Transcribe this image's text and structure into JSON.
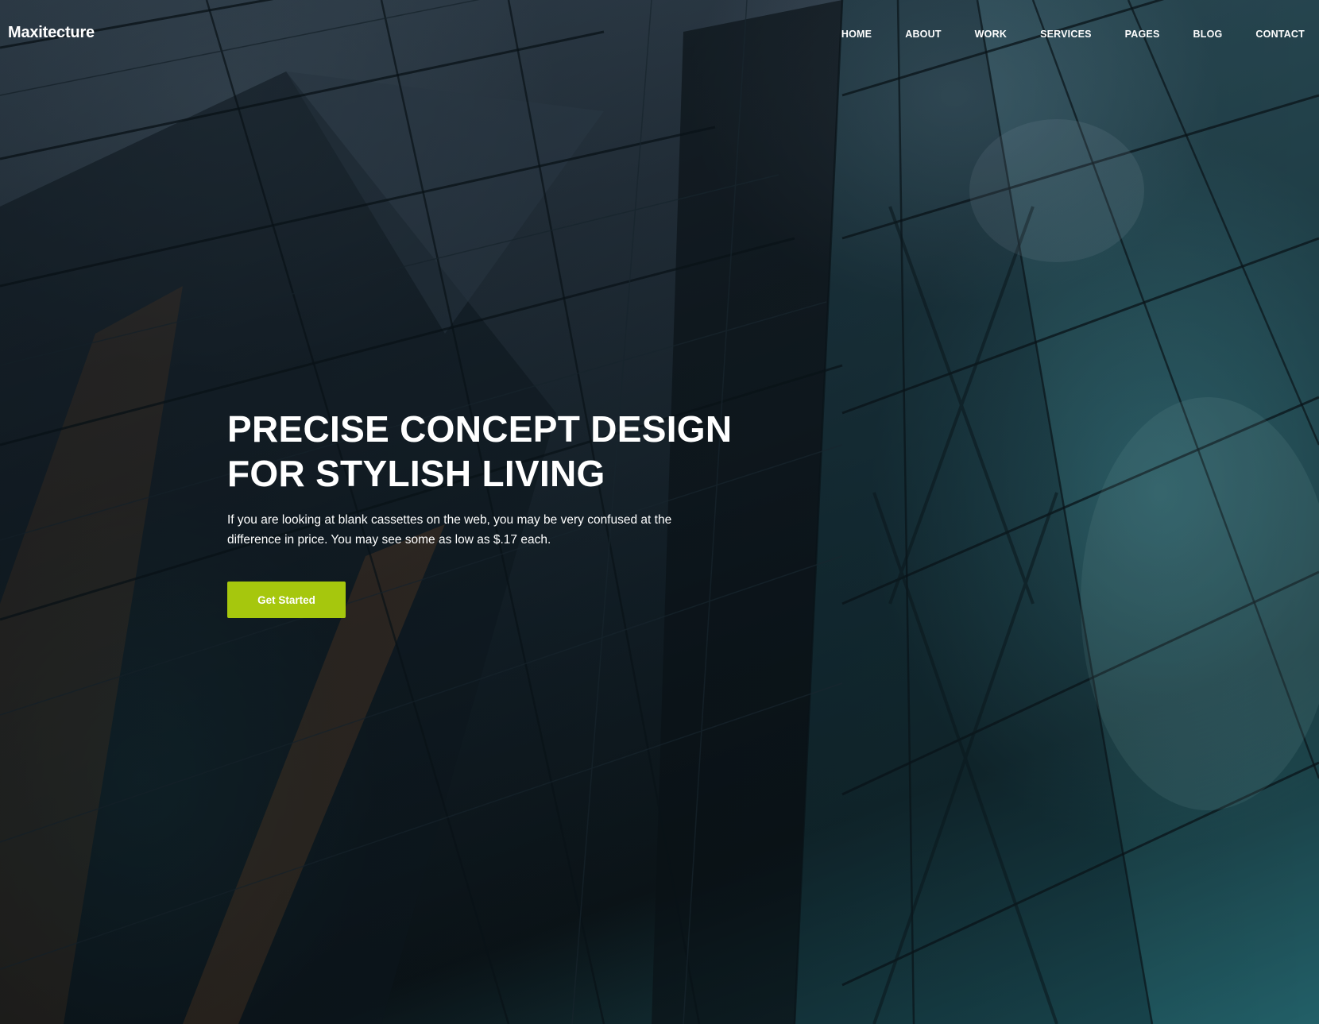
{
  "brand": {
    "name": "Maxitecture"
  },
  "nav": {
    "items": [
      "HOME",
      "ABOUT",
      "WORK",
      "SERVICES",
      "PAGES",
      "BLOG",
      "CONTACT"
    ]
  },
  "hero": {
    "headline_line1": "PRECISE CONCEPT DESIGN",
    "headline_line2": "FOR STYLISH LIVING",
    "subtext": "If you are looking at blank cassettes on the web, you may be very confused at the difference in price. You may see some as low as $.17 each.",
    "cta_label": "Get Started",
    "background_image": "glass-skyscraper-facade"
  },
  "colors": {
    "accent": "#a6c70d",
    "text": "#ffffff"
  }
}
